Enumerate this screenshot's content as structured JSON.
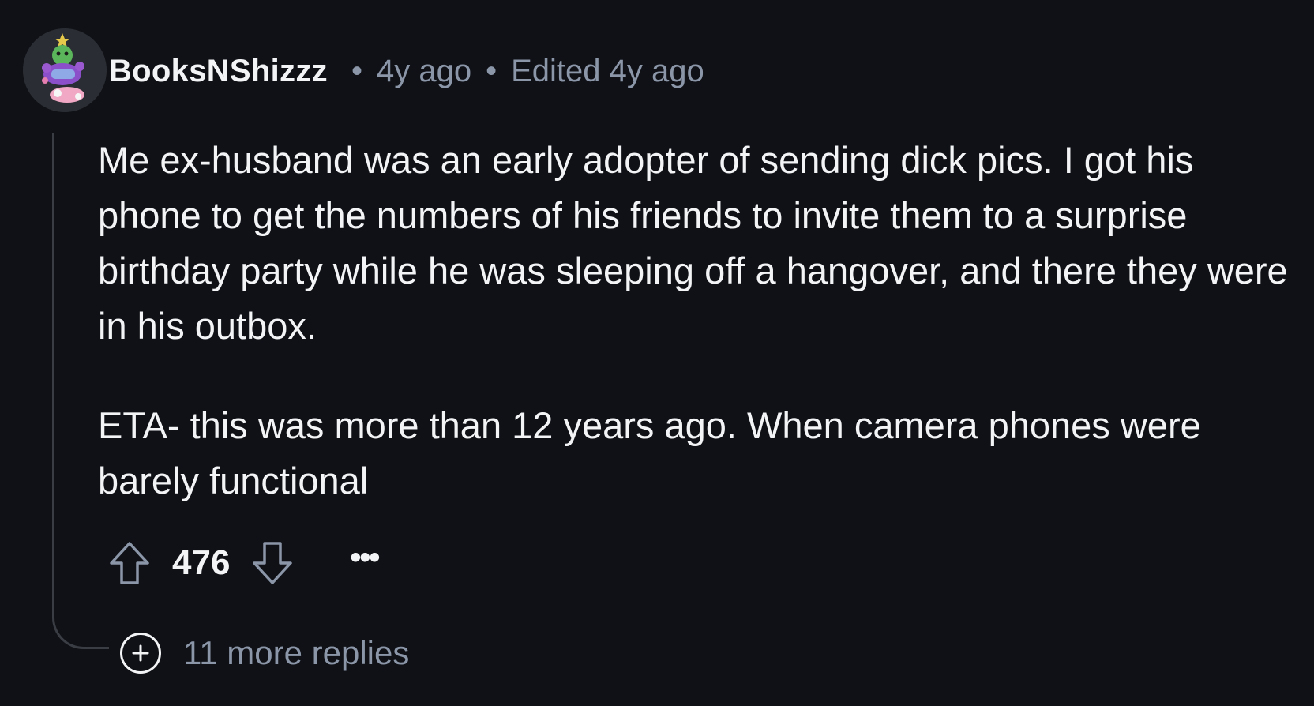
{
  "comment": {
    "author": "BooksNShizzz",
    "posted_ago": "4y ago",
    "edited_label": "Edited 4y ago",
    "separator": "•",
    "body_paragraphs": [
      "Me ex-husband was an early adopter of sending dick pics. I got his phone to get the numbers of his friends to invite them to a surprise birthday party while he was sleeping off a hangover, and there they were in his outbox.",
      "ETA- this was more than 12 years ago. When camera phones were barely functional"
    ],
    "score": "476",
    "more_label": "•••",
    "more_replies": "11 more replies"
  },
  "icons": {
    "upvote": "upvote-arrow-icon",
    "downvote": "downvote-arrow-icon",
    "more": "ellipsis-icon",
    "expand": "plus-circle-icon"
  },
  "colors": {
    "background": "#0f1116",
    "text": "#f2f4f5",
    "meta": "#8b96a8",
    "thread_line": "#3a3d44"
  }
}
